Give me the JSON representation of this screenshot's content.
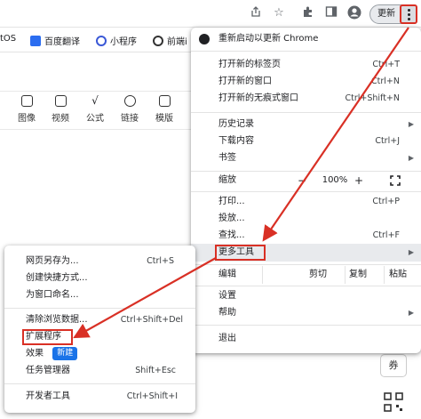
{
  "toolbar": {
    "icons": [
      "share-icon",
      "star-icon",
      "extensions-icon",
      "side-panel-icon",
      "profile-icon"
    ],
    "update_label": "更新",
    "kebab": "more-menu-icon"
  },
  "bookmarks": {
    "items": [
      {
        "label": "tOS",
        "icon_color": ""
      },
      {
        "label": "百度翻译",
        "icon_color": "#2b6df0"
      },
      {
        "label": "小程序",
        "icon_color": "#3a58d6"
      },
      {
        "label": "前端i",
        "icon_color": "#333333"
      }
    ]
  },
  "page_tools": {
    "items": [
      {
        "label": "图像",
        "icon": "image-icon"
      },
      {
        "label": "视频",
        "icon": "video-icon"
      },
      {
        "label": "公式",
        "icon": "formula-icon"
      },
      {
        "label": "链接",
        "icon": "link-icon"
      },
      {
        "label": "模版",
        "icon": "template-icon"
      }
    ]
  },
  "menu": {
    "relaunch": "重新启动以更新 Chrome",
    "new_tab": {
      "label": "打开新的标签页",
      "shortcut": "Ctrl+T"
    },
    "new_window": {
      "label": "打开新的窗口",
      "shortcut": "Ctrl+N"
    },
    "incognito": {
      "label": "打开新的无痕式窗口",
      "shortcut": "Ctrl+Shift+N"
    },
    "history": {
      "label": "历史记录"
    },
    "downloads": {
      "label": "下载内容",
      "shortcut": "Ctrl+J"
    },
    "bookmarks": {
      "label": "书签"
    },
    "zoom": {
      "label": "缩放",
      "minus": "−",
      "value": "100%",
      "plus": "+"
    },
    "print": {
      "label": "打印...",
      "shortcut": "Ctrl+P"
    },
    "cast": {
      "label": "投放..."
    },
    "find": {
      "label": "查找...",
      "shortcut": "Ctrl+F"
    },
    "more_tools": {
      "label": "更多工具"
    },
    "edit": {
      "label": "编辑",
      "cut": "剪切",
      "copy": "复制",
      "paste": "粘贴"
    },
    "settings": {
      "label": "设置"
    },
    "help": {
      "label": "帮助"
    },
    "exit": {
      "label": "退出"
    }
  },
  "submenu": {
    "save_as": {
      "label": "网页另存为...",
      "shortcut": "Ctrl+S"
    },
    "create_shortcut": {
      "label": "创建快捷方式..."
    },
    "name_window": {
      "label": "为窗口命名..."
    },
    "clear_data": {
      "label": "清除浏览数据...",
      "shortcut": "Ctrl+Shift+Del"
    },
    "extensions": {
      "label": "扩展程序"
    },
    "effects": {
      "label": "效果",
      "badge": "新建"
    },
    "task_manager": {
      "label": "任务管理器",
      "shortcut": "Shift+Esc"
    },
    "devtools": {
      "label": "开发者工具",
      "shortcut": "Ctrl+Shift+I"
    }
  },
  "side_widgets": {
    "coupon": "券"
  },
  "colors": {
    "annotation_red": "#d93025",
    "badge_blue": "#1a73e8",
    "highlight": "#e8eaed"
  }
}
